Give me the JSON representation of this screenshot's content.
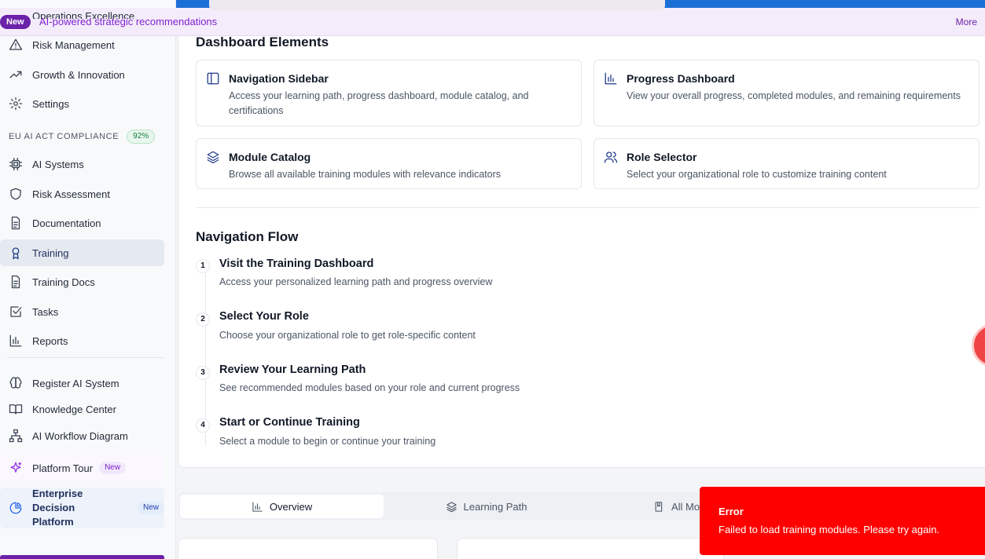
{
  "banner": {
    "badge": "New",
    "text": "AI-powered strategic recommendations",
    "more": "More"
  },
  "sidebar": {
    "top_items": [
      {
        "label": "Operations Excellence",
        "icon": "building-icon"
      },
      {
        "label": "Risk Management",
        "icon": "warning-icon"
      },
      {
        "label": "Growth & Innovation",
        "icon": "trending-up-icon"
      },
      {
        "label": "Settings",
        "icon": "gear-icon"
      }
    ],
    "section_label": "EU AI ACT COMPLIANCE",
    "section_percent": "92%",
    "compliance_items": [
      {
        "label": "AI Systems",
        "icon": "cpu-icon"
      },
      {
        "label": "Risk Assessment",
        "icon": "shield-icon"
      },
      {
        "label": "Documentation",
        "icon": "document-icon"
      },
      {
        "label": "Training",
        "icon": "award-icon",
        "active": true
      },
      {
        "label": "Training Docs",
        "icon": "document-icon"
      },
      {
        "label": "Tasks",
        "icon": "checkbox-icon"
      },
      {
        "label": "Reports",
        "icon": "bar-chart-icon"
      }
    ],
    "extra_items": [
      {
        "label": "Register AI System",
        "icon": "brain-icon"
      },
      {
        "label": "Knowledge Center",
        "icon": "book-icon"
      },
      {
        "label": "AI Workflow Diagram",
        "icon": "workflow-icon"
      }
    ],
    "tour": {
      "label": "Platform Tour",
      "badge": "New"
    },
    "enterprise": {
      "label_line1": "Enterprise Decision",
      "label_line2": "Platform",
      "badge": "New"
    }
  },
  "main": {
    "elements_heading": "Dashboard Elements",
    "elements": [
      {
        "title": "Navigation Sidebar",
        "desc": "Access your learning path, progress dashboard, module catalog, and certifications",
        "icon": "sidebar-icon"
      },
      {
        "title": "Progress Dashboard",
        "desc": "View your overall progress, completed modules, and remaining requirements",
        "icon": "bar-chart-icon"
      },
      {
        "title": "Module Catalog",
        "desc": "Browse all available training modules with relevance indicators",
        "icon": "layers-icon"
      },
      {
        "title": "Role Selector",
        "desc": "Select your organizational role to customize training content",
        "icon": "users-icon"
      }
    ],
    "flow_heading": "Navigation Flow",
    "steps": [
      {
        "num": "1",
        "title": "Visit the Training Dashboard",
        "desc": "Access your personalized learning path and progress overview"
      },
      {
        "num": "2",
        "title": "Select Your Role",
        "desc": "Choose your organizational role to get role-specific content"
      },
      {
        "num": "3",
        "title": "Review Your Learning Path",
        "desc": "See recommended modules based on your role and current progress"
      },
      {
        "num": "4",
        "title": "Start or Continue Training",
        "desc": "Select a module to begin or continue your training"
      }
    ]
  },
  "tabs": [
    {
      "label": "Overview",
      "icon": "bar-chart-icon",
      "active": true
    },
    {
      "label": "Learning Path",
      "icon": "layers-icon"
    },
    {
      "label": "All Mo",
      "icon": "book-icon"
    }
  ],
  "toast": {
    "title": "Error",
    "message": "Failed to load training modules. Please try again.",
    "color": "#ff0000"
  },
  "colors": {
    "accent": "#6b21a8",
    "active_nav": "#e5e9f0",
    "success": "#15803d"
  }
}
